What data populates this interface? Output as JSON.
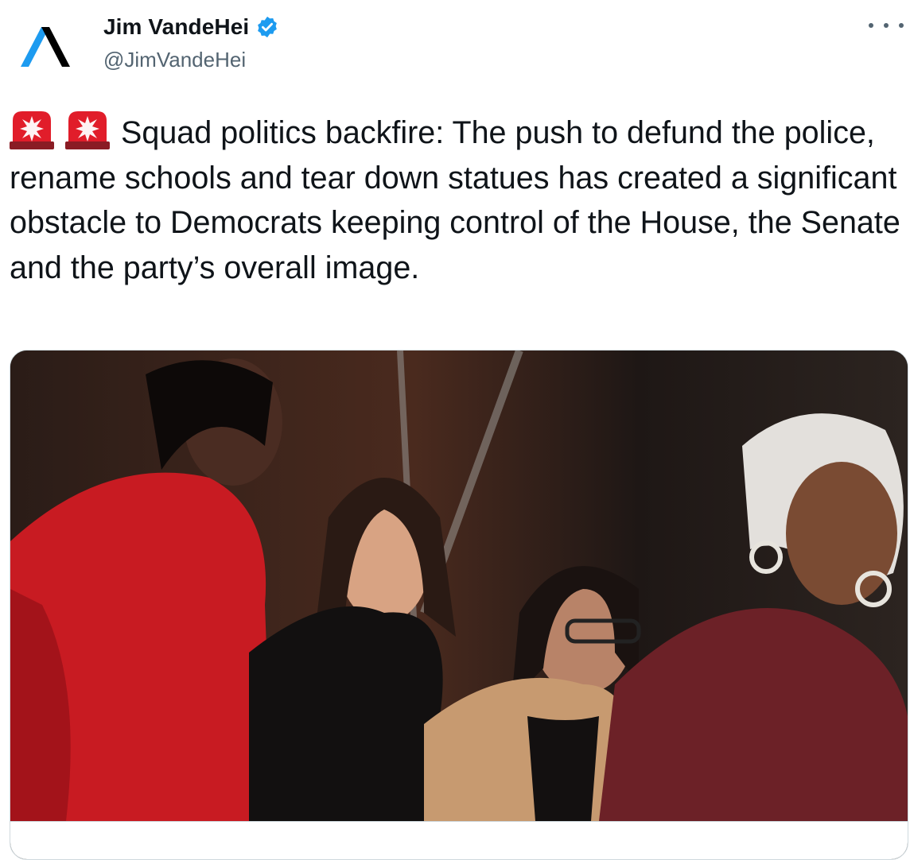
{
  "author": {
    "name": "Jim VandeHei",
    "handle": "@JimVandeHei",
    "avatar_icon": "axios-logo-icon",
    "verified_icon": "verified-badge-icon"
  },
  "tweet": {
    "emoji": [
      "🚨",
      "🚨"
    ],
    "text": "Squad politics backfire: The push to defund the police, rename schools and tear down statues has created a significant obstacle to Democrats keeping control of the House, the Senate and the party’s overall image."
  },
  "colors": {
    "accent": "#1d9bf0",
    "text": "#0f1419",
    "secondary": "#536471",
    "border": "#cfd9de"
  }
}
